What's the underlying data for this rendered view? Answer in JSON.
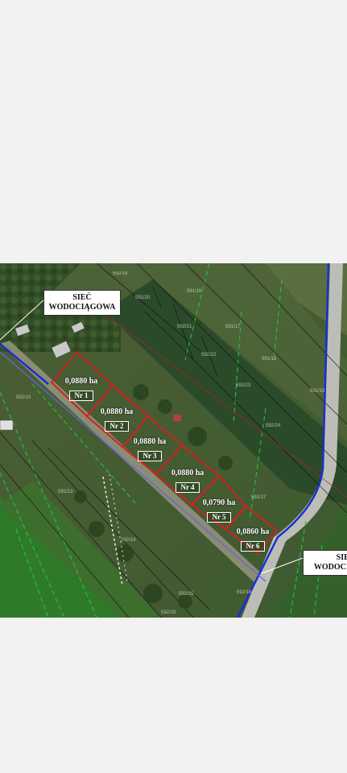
{
  "map": {
    "callouts": [
      {
        "line1": "SIEĆ",
        "line2": "WODOCIĄGOWA"
      },
      {
        "line1": "SIEĆ",
        "line2": "WODOCIĄ"
      }
    ],
    "plots": [
      {
        "area": "0,0880 ha",
        "nr": "Nr 1"
      },
      {
        "area": "0,0880 ha",
        "nr": "Nr 2"
      },
      {
        "area": "0,0880 ha",
        "nr": "Nr 3"
      },
      {
        "area": "0,0880 ha",
        "nr": "Nr 4"
      },
      {
        "area": "0,0790 ha",
        "nr": "Nr 5"
      },
      {
        "area": "0,0860 ha",
        "nr": "Nr 6"
      }
    ],
    "parcel_numbers": [
      "592/19",
      "592/20",
      "591/16",
      "592/21",
      "591/17",
      "592/22",
      "591/18",
      "592/23",
      "591/19",
      "592/24",
      "592/10",
      "592/13",
      "592/14",
      "592/15",
      "592/16",
      "592/17",
      "592/18"
    ],
    "colors": {
      "plot_outline": "#d42020",
      "water_pipe": "#1a2fd0",
      "parcel_green": "#22c43a",
      "road": "#c8c8c8"
    }
  }
}
